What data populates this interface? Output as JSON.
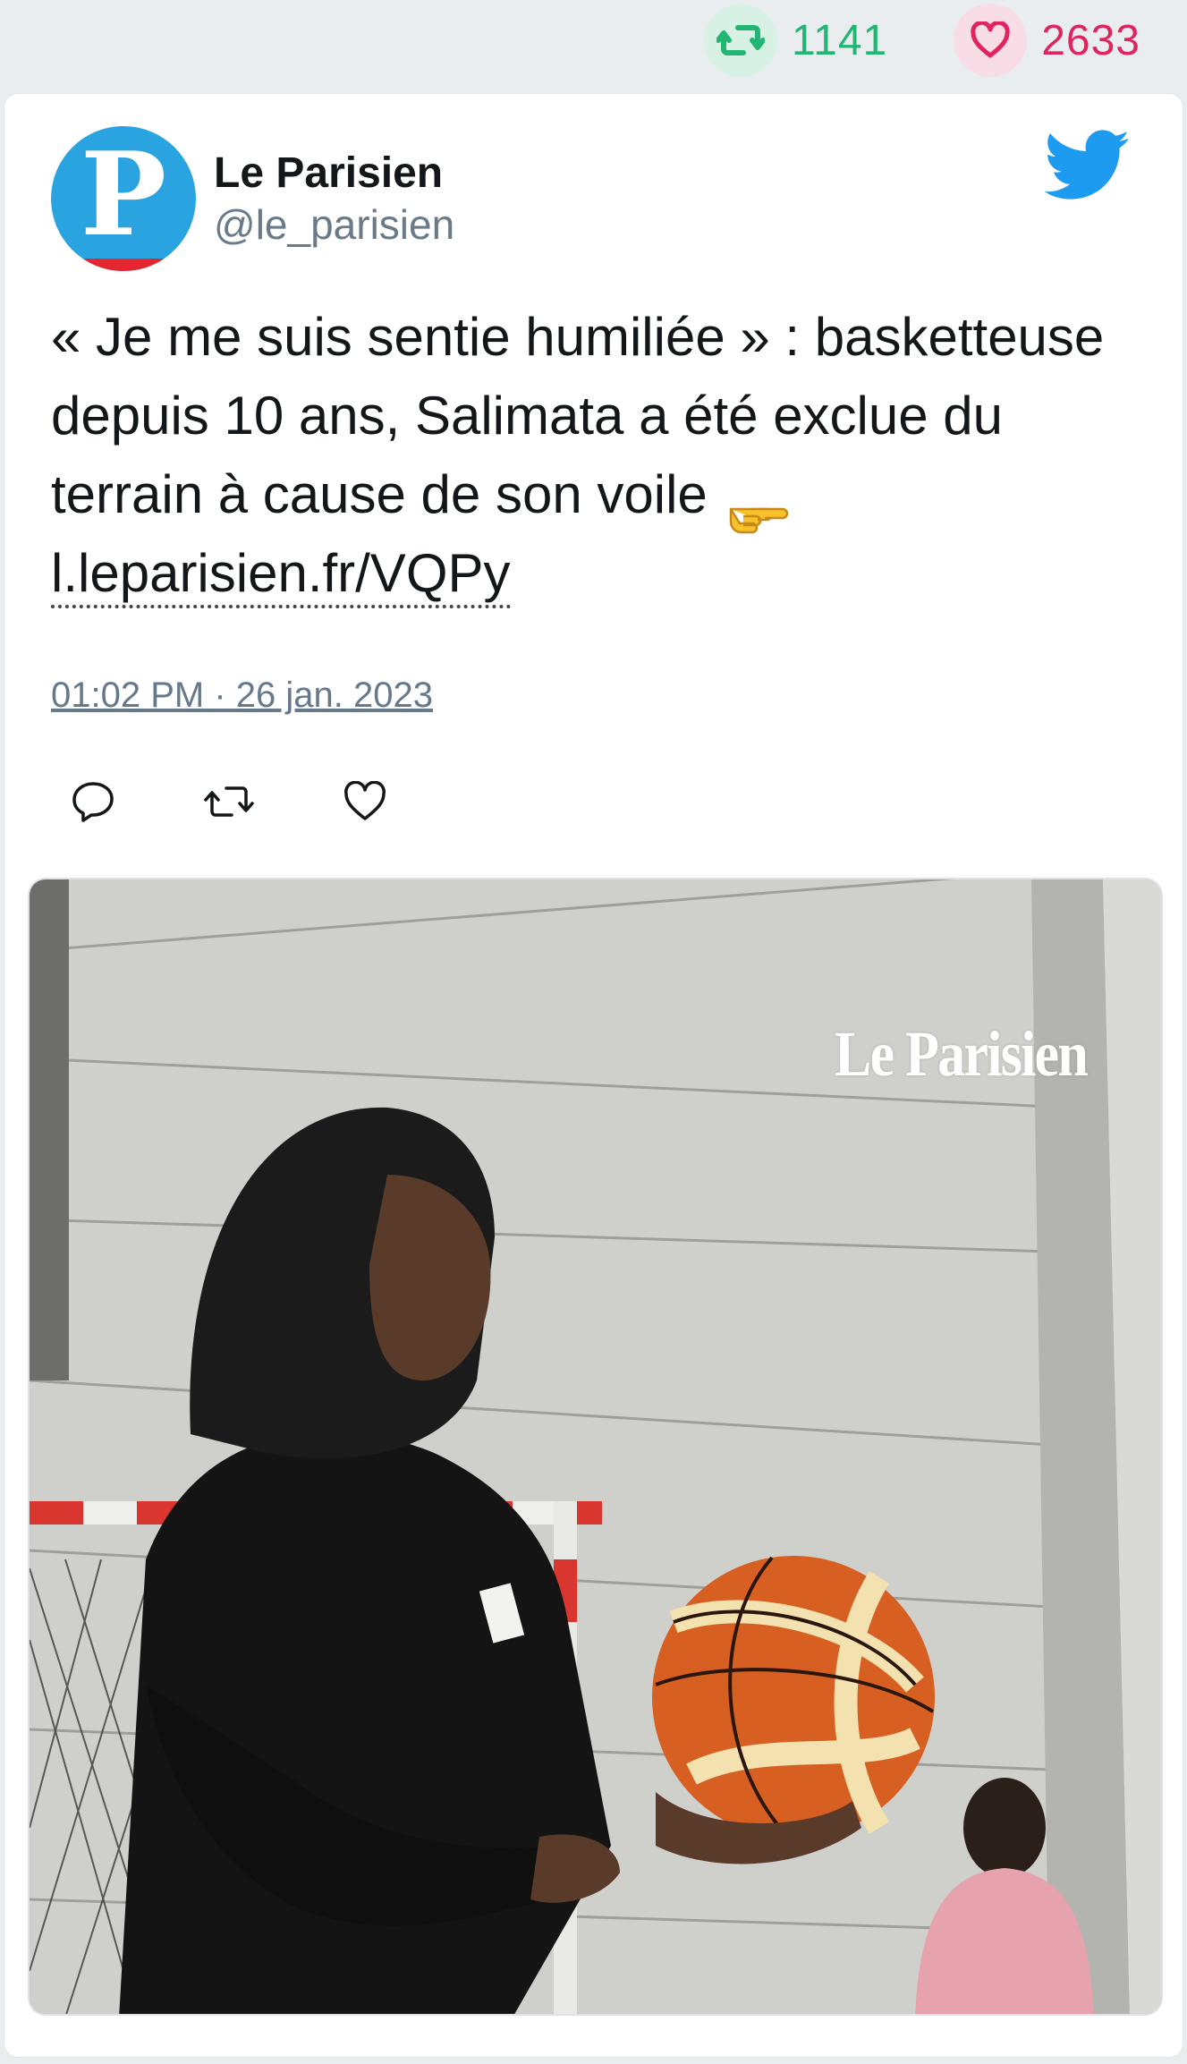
{
  "stats": {
    "retweets": "1141",
    "likes": "2633",
    "retweet_color": "#22b573",
    "like_color": "#e0245e",
    "retweet_icon": "retweet-icon",
    "like_icon": "heart-icon"
  },
  "tweet": {
    "display_name": "Le Parisien",
    "handle": "@le_parisien",
    "avatar_letter": "P",
    "text_main": "« Je me suis sentie humiliée » : basketteuse depuis 10 ans, Salimata a été exclue du terrain à cause de son voile",
    "emoji": "backhand-index-pointing-right-icon",
    "link": "l.leparisien.fr/VQPy",
    "timestamp": "01:02 PM · 26 jan. 2023",
    "brand_icon": "twitter-bird-icon",
    "brand_color": "#1d9bf0"
  },
  "actions": [
    {
      "name": "reply",
      "icon": "reply-icon"
    },
    {
      "name": "retweet",
      "icon": "retweet-icon"
    },
    {
      "name": "like",
      "icon": "heart-icon"
    }
  ],
  "media": {
    "watermark": "Le Parisien"
  }
}
